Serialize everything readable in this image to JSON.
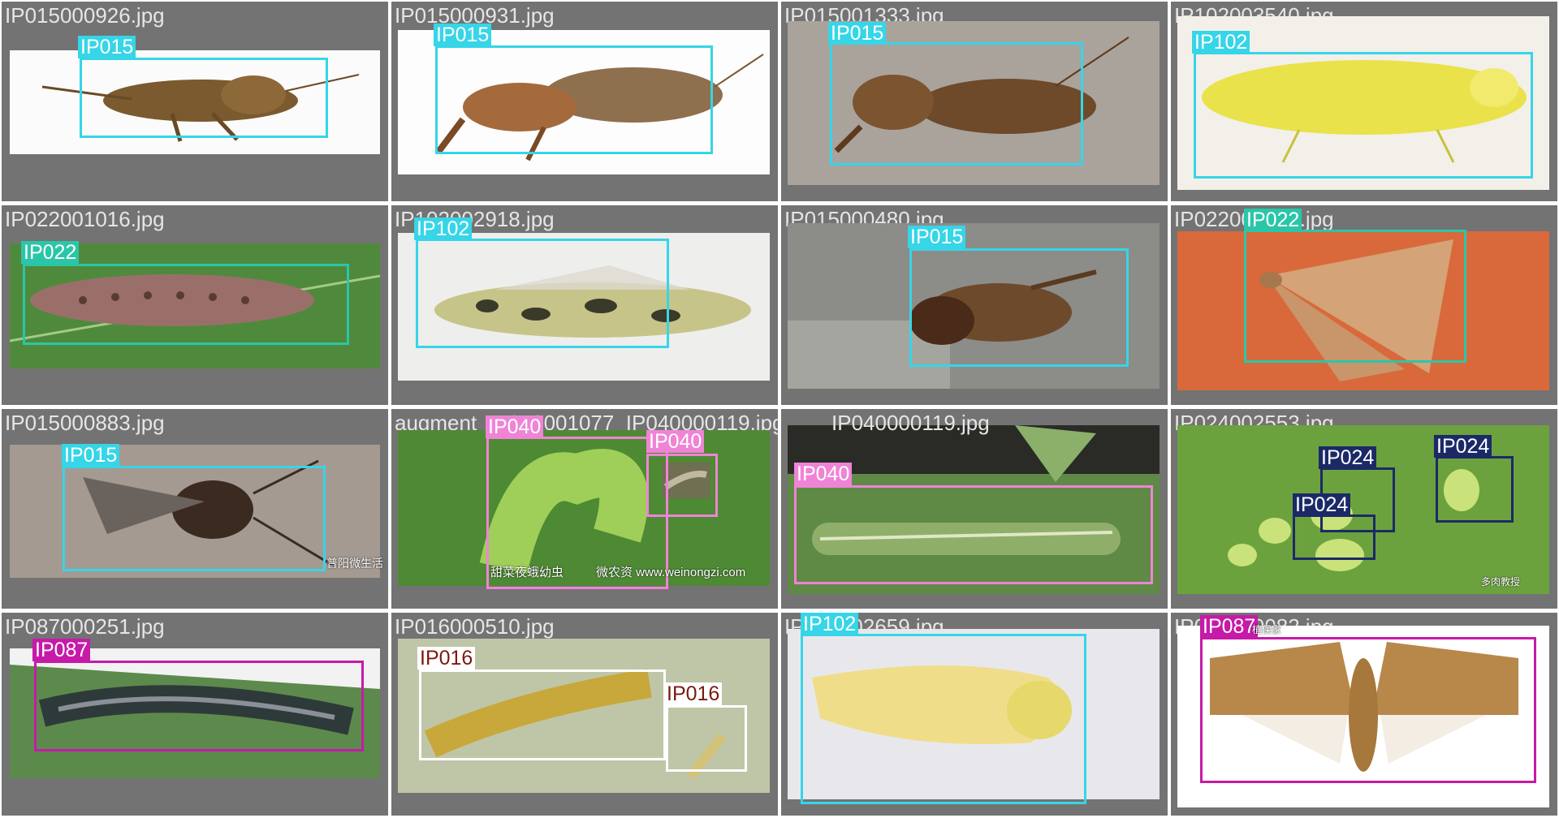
{
  "colors": {
    "IP015": {
      "box": "#36d5e8",
      "label_bg": "#36d5e8",
      "label_fg": "#ffffff"
    },
    "IP102": {
      "box": "#36d5e8",
      "label_bg": "#36d5e8",
      "label_fg": "#ffffff"
    },
    "IP022": {
      "box": "#2bc6a8",
      "label_bg": "#2bc6a8",
      "label_fg": "#ffffff"
    },
    "IP040": {
      "box": "#ef84d6",
      "label_bg": "#ef84d6",
      "label_fg": "#ffffff"
    },
    "IP024": {
      "box": "#1b2a66",
      "label_bg": "#1b2a66",
      "label_fg": "#ffffff"
    },
    "IP087": {
      "box": "#c61aa8",
      "label_bg": "#c61aa8",
      "label_fg": "#ffffff"
    },
    "IP016": {
      "box": "#ffffff",
      "label_bg": "#ffffff",
      "label_fg": "#7a1a10"
    }
  },
  "tiles": [
    {
      "filename": "IP015000926.jpg",
      "subject": "mole-cricket",
      "labels": [
        "IP015"
      ]
    },
    {
      "filename": "IP015000931.jpg",
      "subject": "mole-cricket",
      "labels": [
        "IP015"
      ]
    },
    {
      "filename": "IP015001333.jpg",
      "subject": "mole-cricket",
      "labels": [
        "IP015"
      ]
    },
    {
      "filename": "IP102003540.jpg",
      "subject": "leafhopper",
      "labels": [
        "IP102"
      ]
    },
    {
      "filename": "IP022001016.jpg",
      "subject": "larva",
      "labels": [
        "IP022"
      ]
    },
    {
      "filename": "IP102002918.jpg",
      "subject": "leafhopper-nymph",
      "labels": [
        "IP102"
      ]
    },
    {
      "filename": "IP015000480.jpg",
      "subject": "mole-cricket",
      "labels": [
        "IP015"
      ]
    },
    {
      "filename": "IP022005833.jpg",
      "subject": "moth",
      "labels": [
        "IP022"
      ]
    },
    {
      "filename": "IP015000883.jpg",
      "subject": "mole-cricket",
      "labels": [
        "IP015"
      ],
      "watermark": "普阳微生活"
    },
    {
      "filename": "augment_IP040001077_IP040000119.jpg",
      "subject": "green-caterpillar",
      "labels": [
        "IP040",
        "IP040"
      ],
      "watermark_left": "甜菜夜蛾幼虫",
      "watermark_right": "微农资 www.weinongzi.com"
    },
    {
      "filename": "IP040000119.jpg",
      "subject": "green-caterpillar",
      "labels": [
        "IP040"
      ]
    },
    {
      "filename": "IP024002553.jpg",
      "subject": "aphids",
      "labels": [
        "IP024",
        "IP024",
        "IP024"
      ],
      "watermark": "多肉教授"
    },
    {
      "filename": "IP087000251.jpg",
      "subject": "dark-larva",
      "labels": [
        "IP087"
      ]
    },
    {
      "filename": "IP016000510.jpg",
      "subject": "wireworm",
      "labels": [
        "IP016",
        "IP016"
      ]
    },
    {
      "filename": "IP102002659.jpg",
      "subject": "leafhopper",
      "labels": [
        "IP102"
      ]
    },
    {
      "filename": "IP087000082.jpg",
      "subject": "moth",
      "labels": [
        "IP087"
      ],
      "watermark": "植保家"
    }
  ]
}
